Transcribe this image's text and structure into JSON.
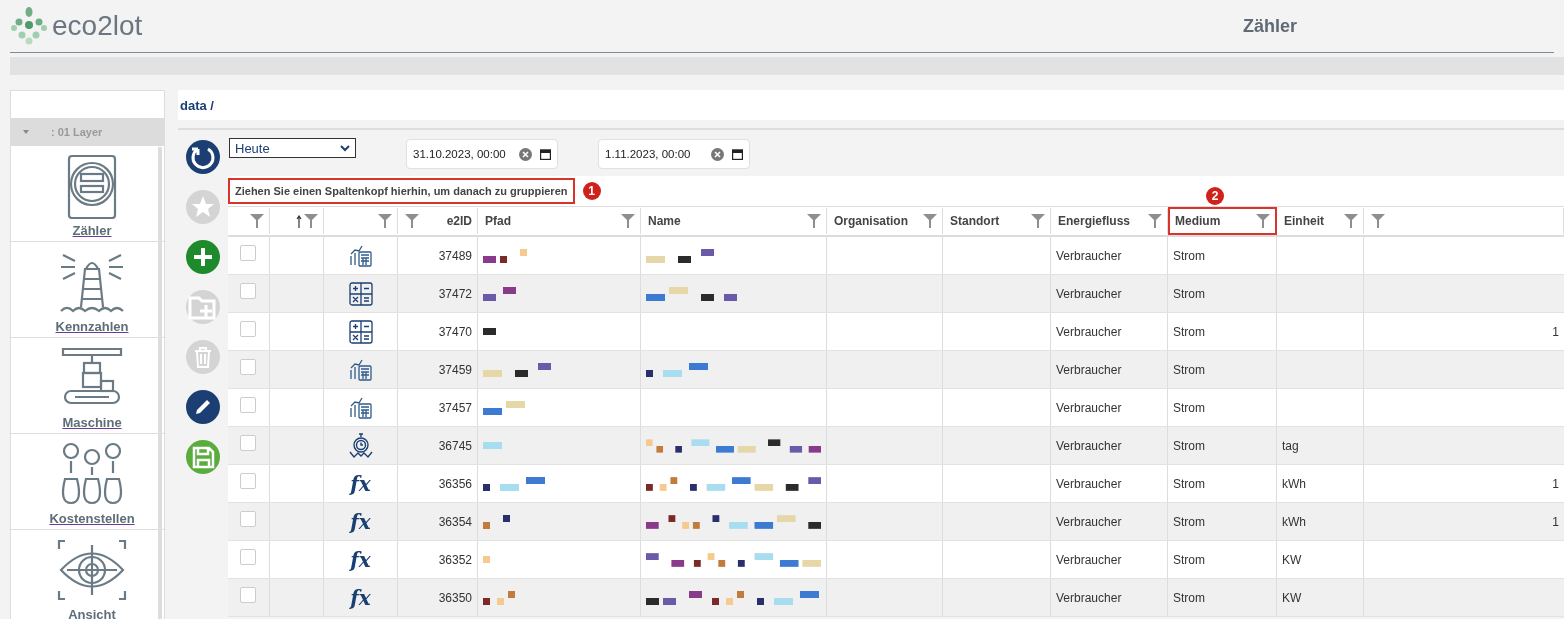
{
  "header": {
    "logo_text": "eco2lot",
    "title": "Zähler"
  },
  "sidebar": {
    "group": {
      "label": ": 01 Layer",
      "expanded": true
    },
    "items": [
      {
        "kind": "meter",
        "label": "Zähler"
      },
      {
        "kind": "lighthouse",
        "label": "Kennzahlen"
      },
      {
        "kind": "machine",
        "label": "Maschine"
      },
      {
        "kind": "money",
        "label": "Kostenstellen"
      },
      {
        "kind": "eye",
        "label": "Ansicht"
      }
    ]
  },
  "breadcrumb": "data /",
  "toolbar_buttons": [
    {
      "kind": "refresh",
      "disabled": false
    },
    {
      "kind": "star",
      "disabled": true
    },
    {
      "kind": "add",
      "disabled": false
    },
    {
      "kind": "add-folder",
      "disabled": true
    },
    {
      "kind": "delete",
      "disabled": true
    },
    {
      "kind": "edit",
      "disabled": false
    },
    {
      "kind": "save",
      "disabled": false
    }
  ],
  "filters": {
    "period": "Heute",
    "from": "31.10.2023, 00:00",
    "to": "1.11.2023, 00:00"
  },
  "group_panel": {
    "hint": "Ziehen Sie einen Spaltenkopf hierhin, um danach zu gruppieren",
    "highlighted": true,
    "badge": "1"
  },
  "table": {
    "columns": [
      {
        "sorted": false,
        "highlighted": false
      },
      {
        "sorted": true,
        "highlighted": false
      },
      {
        "sorted": false,
        "highlighted": false
      },
      {
        "label": "e2ID",
        "sorted": false,
        "highlighted": false
      },
      {
        "label": "Pfad",
        "sorted": false,
        "highlighted": false
      },
      {
        "label": "Name",
        "sorted": false,
        "highlighted": false
      },
      {
        "label": "Organisation",
        "sorted": false,
        "highlighted": false
      },
      {
        "label": "Standort",
        "sorted": false,
        "highlighted": false
      },
      {
        "label": "Energiefluss",
        "sorted": false,
        "highlighted": false
      },
      {
        "label": "Medium",
        "sorted": false,
        "highlighted": true,
        "badge": "2"
      },
      {
        "label": "Einheit",
        "sorted": false,
        "highlighted": false
      },
      {
        "sorted": false,
        "highlighted": false
      }
    ],
    "rows": [
      {
        "checked": false,
        "kind": "chart-calculator",
        "e2id": "37489",
        "energiefluss": "Verbraucher",
        "medium": "Strom"
      },
      {
        "checked": false,
        "kind": "calculator",
        "e2id": "37472",
        "energiefluss": "Verbraucher",
        "medium": "Strom"
      },
      {
        "checked": false,
        "kind": "calculator",
        "e2id": "37470",
        "energiefluss": "Verbraucher",
        "medium": "Strom",
        "column_12": "1"
      },
      {
        "checked": false,
        "kind": "chart-calculator",
        "e2id": "37459",
        "energiefluss": "Verbraucher",
        "medium": "Strom"
      },
      {
        "checked": false,
        "kind": "chart-calculator",
        "e2id": "37457",
        "energiefluss": "Verbraucher",
        "medium": "Strom"
      },
      {
        "checked": false,
        "kind": "stopwatch",
        "e2id": "36745",
        "energiefluss": "Verbraucher",
        "medium": "Strom",
        "einheit": "tag"
      },
      {
        "checked": false,
        "kind": "formula",
        "symbol": "fx",
        "e2id": "36356",
        "energiefluss": "Verbraucher",
        "medium": "Strom",
        "einheit": "kWh",
        "column_12": "1"
      },
      {
        "checked": false,
        "kind": "formula",
        "symbol": "fx",
        "e2id": "36354",
        "energiefluss": "Verbraucher",
        "medium": "Strom",
        "einheit": "kWh",
        "column_12": "1"
      },
      {
        "checked": false,
        "kind": "formula",
        "symbol": "fx",
        "e2id": "36352",
        "energiefluss": "Verbraucher",
        "medium": "Strom",
        "einheit": "KW"
      },
      {
        "checked": false,
        "kind": "formula",
        "symbol": "fx",
        "e2id": "36350",
        "energiefluss": "Verbraucher",
        "medium": "Strom",
        "einheit": "KW"
      }
    ]
  }
}
